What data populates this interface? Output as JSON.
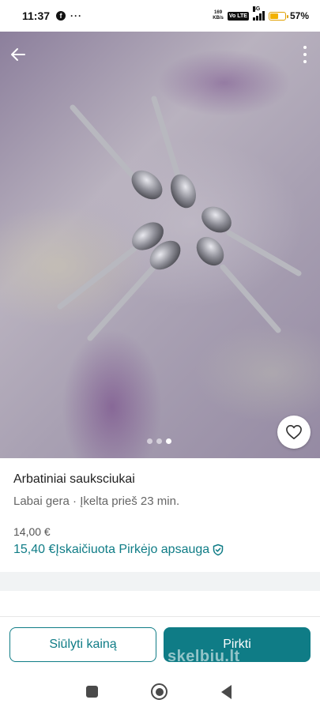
{
  "status_bar": {
    "time": "11:37",
    "app_icon": "facebook-icon",
    "more_notifications": "···",
    "net_speed_value": "169",
    "net_speed_unit": "KB/s",
    "volte": "Vo LTE",
    "network": "4G",
    "battery_level_percent": 57,
    "battery_text": "57%",
    "battery_color": "#f2b100"
  },
  "photo": {
    "page_count": 3,
    "active_page": 3
  },
  "listing": {
    "title": "Arbatiniai sauksciukai",
    "subtitle": "Labai gera · Įkelta prieš 23 min.",
    "price": "14,00 €",
    "total_price": "15,40 €",
    "protection_label": "Įskaičiuota Pirkėjo apsauga"
  },
  "actions": {
    "offer_label": "Siūlyti kainą",
    "buy_label": "Pirkti"
  },
  "watermark": "skelbiu.lt",
  "colors": {
    "accent": "#0f7c86"
  }
}
